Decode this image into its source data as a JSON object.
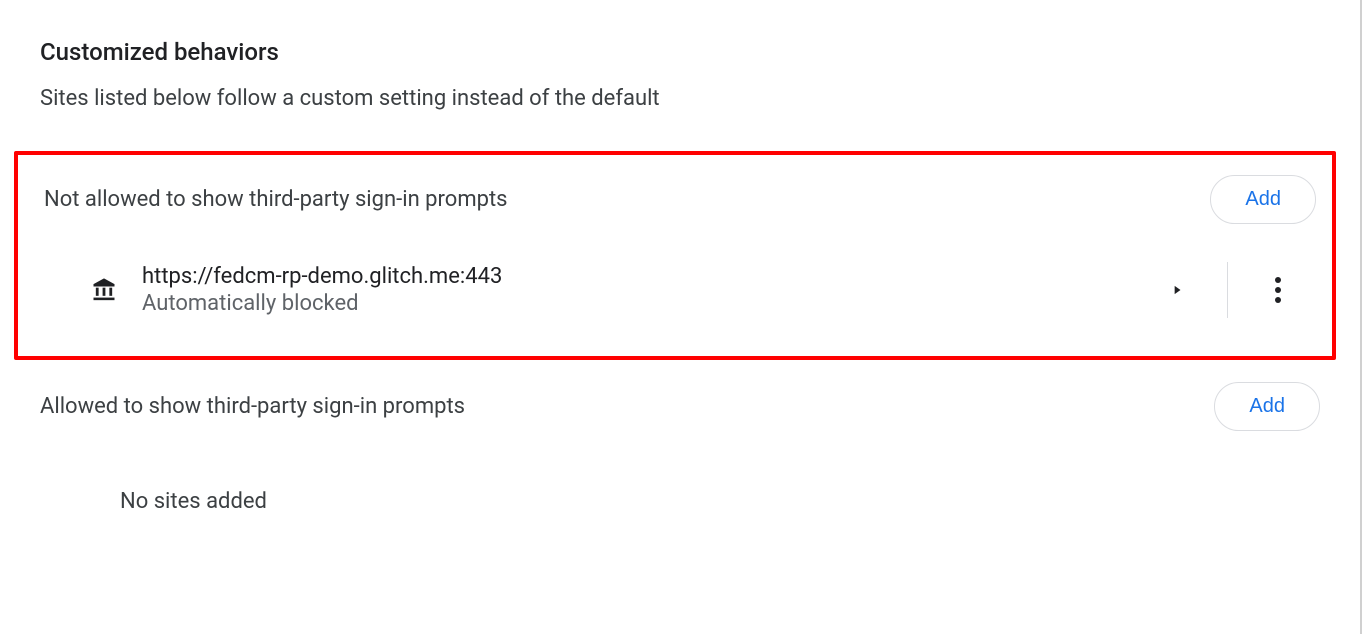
{
  "section": {
    "title": "Customized behaviors",
    "description": "Sites listed below follow a custom setting instead of the default"
  },
  "notAllowed": {
    "header": "Not allowed to show third-party sign-in prompts",
    "add_label": "Add",
    "items": [
      {
        "url": "https://fedcm-rp-demo.glitch.me:443",
        "status": "Automatically blocked"
      }
    ]
  },
  "allowed": {
    "header": "Allowed to show third-party sign-in prompts",
    "add_label": "Add",
    "empty_text": "No sites added"
  }
}
